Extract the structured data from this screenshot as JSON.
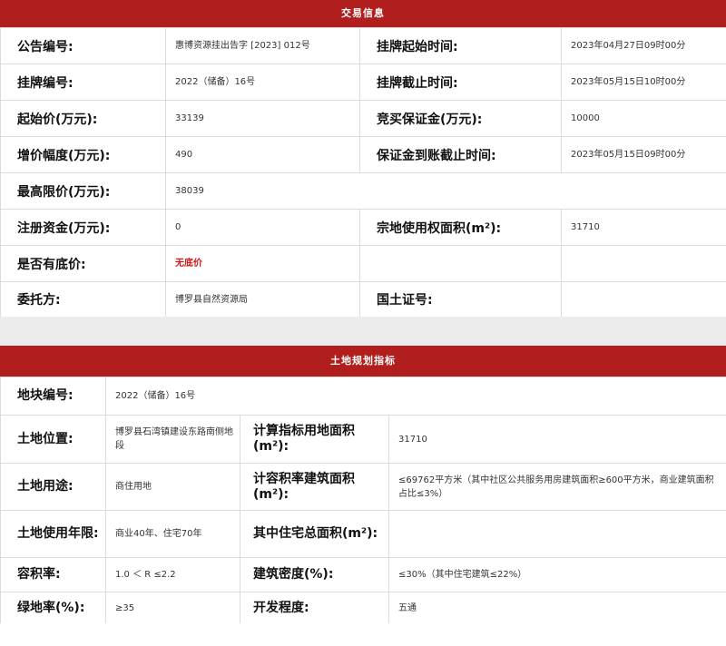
{
  "trade_info": {
    "title": "交易信息",
    "rows": [
      [
        {
          "label": "公告编号:",
          "value": "惠博资源挂出告字 [2023] 012号"
        },
        {
          "label": "挂牌起始时间:",
          "value": "2023年04月27日09时00分"
        }
      ],
      [
        {
          "label": "挂牌编号:",
          "value": "2022（储备）16号"
        },
        {
          "label": "挂牌截止时间:",
          "value": "2023年05月15日10时00分"
        }
      ],
      [
        {
          "label": "起始价(万元):",
          "value": "33139"
        },
        {
          "label": "竞买保证金(万元):",
          "value": "10000"
        }
      ],
      [
        {
          "label": "增价幅度(万元):",
          "value": "490"
        },
        {
          "label": "保证金到账截止时间:",
          "value": "2023年05月15日09时00分"
        }
      ],
      [
        {
          "label": "最高限价(万元):",
          "value": "38039"
        },
        {
          "label": "",
          "value": ""
        }
      ],
      [
        {
          "label": "注册资金(万元):",
          "value": "0"
        },
        {
          "label": "宗地使用权面积(m²):",
          "value": "31710"
        }
      ],
      [
        {
          "label": "是否有底价:",
          "value": "无底价"
        },
        {
          "label": "",
          "value": ""
        }
      ],
      [
        {
          "label": "委托方:",
          "value": "博罗县自然资源局"
        },
        {
          "label": "国土证号:",
          "value": ""
        }
      ]
    ]
  },
  "land_plan": {
    "title": "土地规划指标",
    "parcel_no": {
      "label": "地块编号:",
      "value": "2022（储备）16号"
    },
    "rows": [
      [
        {
          "label": "土地位置:",
          "value": "博罗县石湾镇建设东路南侧地段"
        },
        {
          "label": "计算指标用地面积(m²):",
          "value": "31710"
        }
      ],
      [
        {
          "label": "土地用途:",
          "value": "商住用地"
        },
        {
          "label": "计容积率建筑面积(m²):",
          "value": "≤69762平方米（其中社区公共服务用房建筑面积≥600平方米，商业建筑面积占比≤3%）"
        }
      ],
      [
        {
          "label": "土地使用年限:",
          "value": "商业40年、住宅70年"
        },
        {
          "label": "其中住宅总面积(m²):",
          "value": ""
        }
      ],
      [
        {
          "label": "容积率:",
          "value": "1.0 ＜ R ≤2.2"
        },
        {
          "label": "建筑密度(%):",
          "value": "≤30%（其中住宅建筑≤22%）"
        }
      ],
      [
        {
          "label": "绿地率(%):",
          "value": "≥35"
        },
        {
          "label": "开发程度:",
          "value": "五通"
        }
      ]
    ]
  }
}
